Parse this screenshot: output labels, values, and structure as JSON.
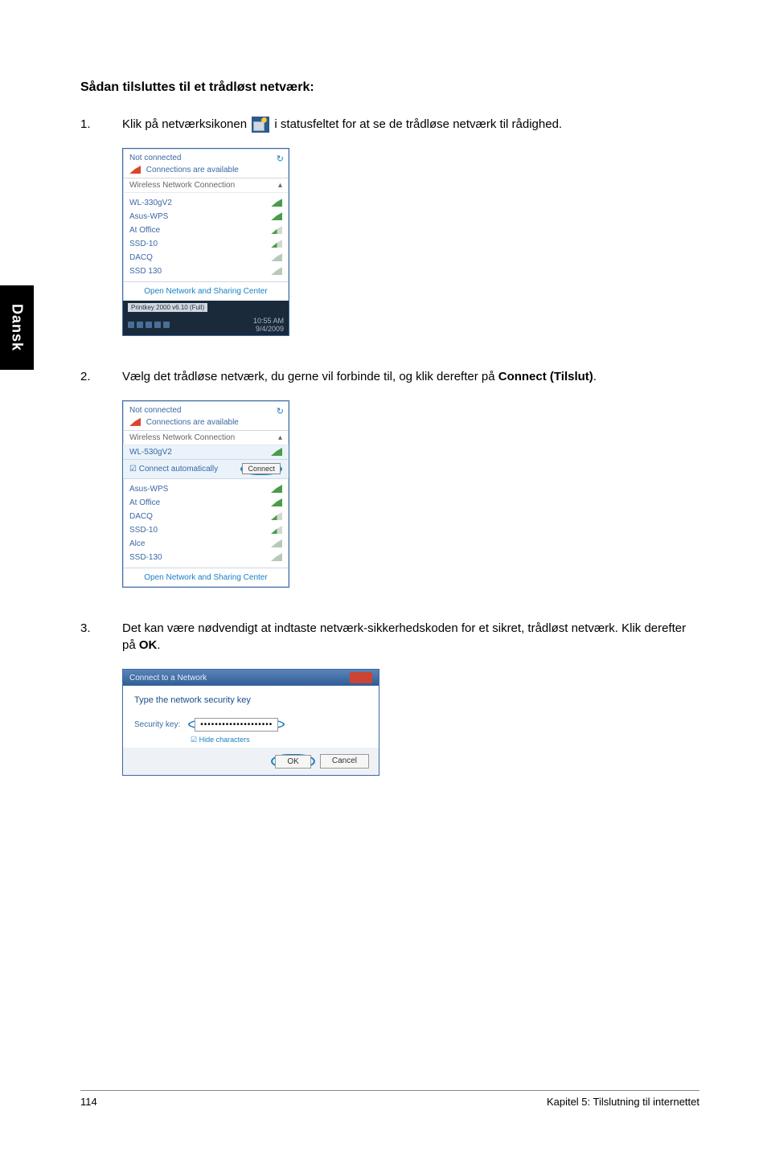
{
  "sideTab": "Dansk",
  "heading": "Sådan tilsluttes til et trådløst netværk:",
  "steps": {
    "s1": {
      "num": "1.",
      "pre": "Klik på netværksikonen ",
      "post": " i statusfeltet for at se de trådløse netværk til rådighed."
    },
    "s2": {
      "num": "2.",
      "text_a": "Vælg det trådløse netværk, du gerne vil forbinde til, og klik derefter på ",
      "bold": "Connect (Tilslut)",
      "text_b": "."
    },
    "s3": {
      "num": "3.",
      "text_a": "Det kan være nødvendigt at indtaste netværk-sikkerhedskoden for et sikret, trådløst netværk. Klik derefter på ",
      "bold": "OK",
      "text_b": "."
    }
  },
  "shot1": {
    "not_connected": "Not connected",
    "available": "Connections are available",
    "refresh": "↻",
    "section": "Wireless Network Connection",
    "caret": "▴",
    "items": [
      "WL-330gV2",
      "Asus-WPS",
      "At Office",
      "SSD-10",
      "DACQ",
      "SSD 130"
    ],
    "open_link": "Open Network and Sharing Center",
    "task_tag": "Printkey 2000 v6.10 (Full)",
    "time": "10:55 AM",
    "date": "9/4/2009"
  },
  "shot2": {
    "not_connected": "Not connected",
    "available": "Connections are available",
    "refresh": "↻",
    "section": "Wireless Network Connection",
    "caret": "▴",
    "selected": "WL-530gV2",
    "auto": "☑ Connect automatically",
    "connect_btn": "Connect",
    "items": [
      "Asus-WPS",
      "At Office",
      "DACQ",
      "SSD-10",
      "Alce",
      "SSD-130"
    ],
    "open_link": "Open Network and Sharing Center"
  },
  "dialog": {
    "title": "Connect to a Network",
    "prompt": "Type the network security key",
    "label": "Security key:",
    "value": "••••••••••••••••••••",
    "hide": "☑ Hide characters",
    "ok": "OK",
    "cancel": "Cancel"
  },
  "footer": {
    "page": "114",
    "chapter": "Kapitel 5: Tilslutning til internettet"
  }
}
